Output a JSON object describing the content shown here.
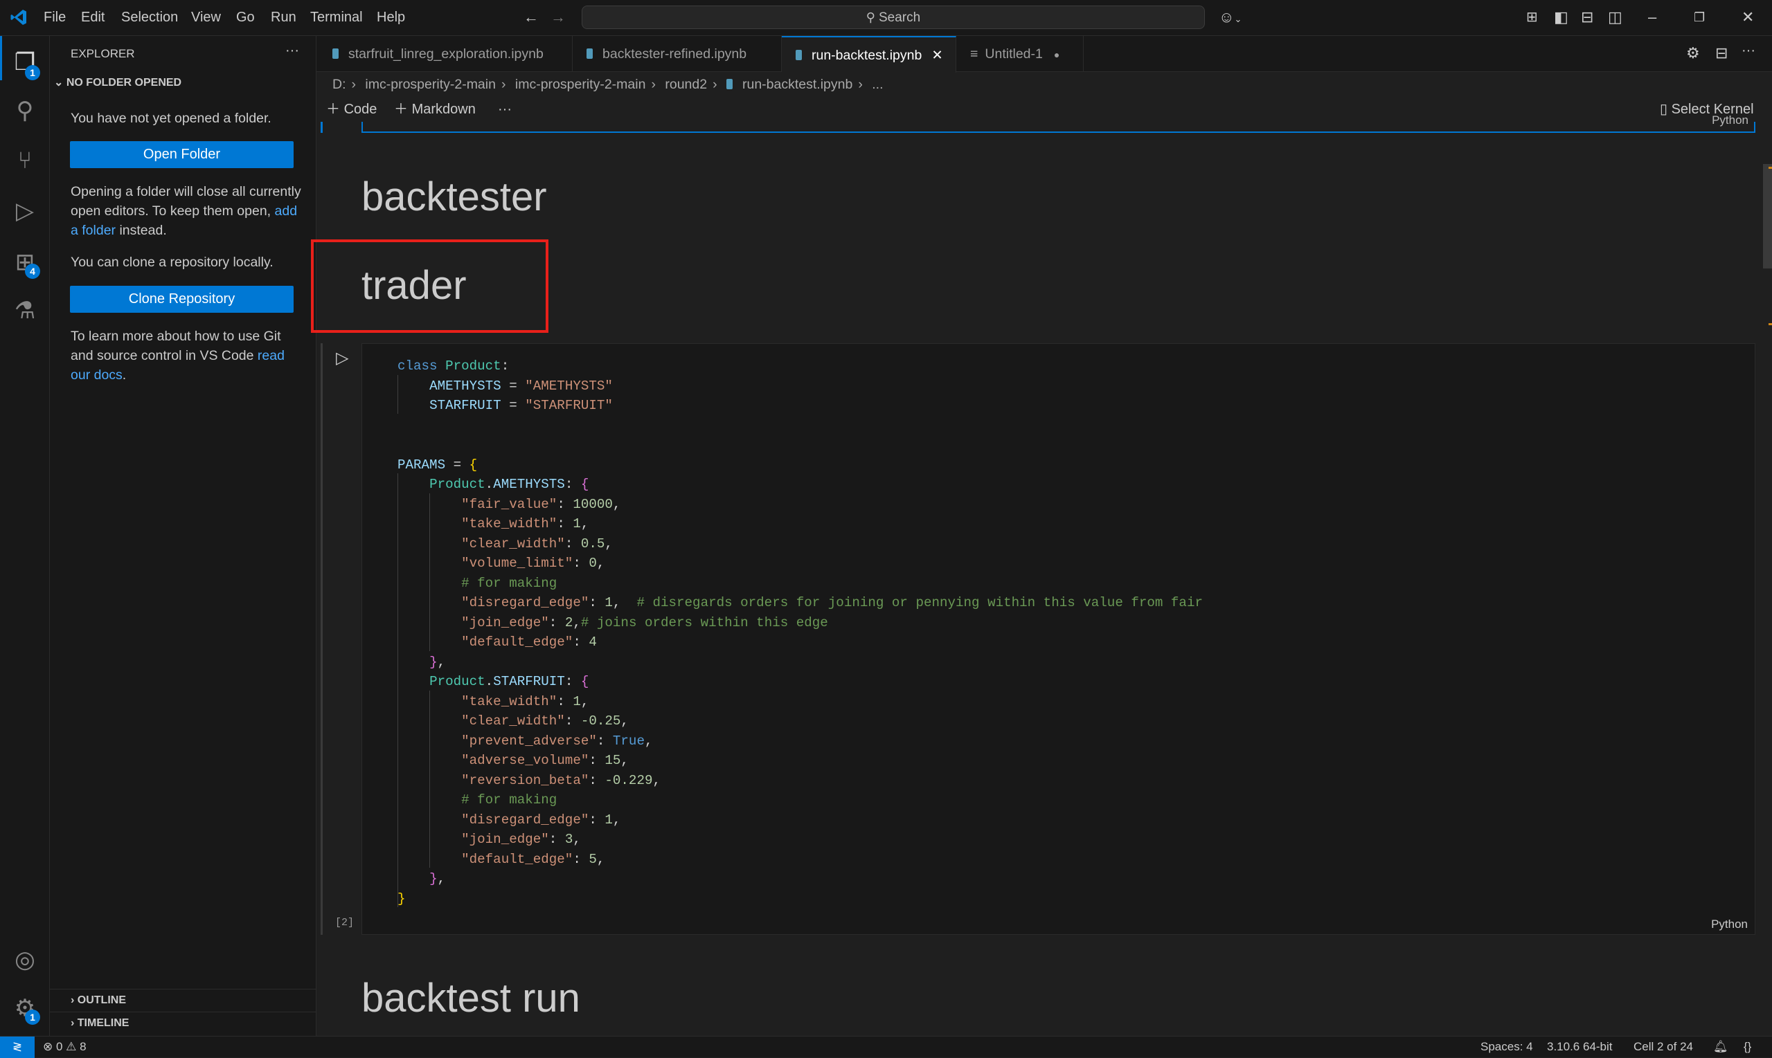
{
  "titlebar": {
    "menu": [
      "File",
      "Edit",
      "Selection",
      "View",
      "Go",
      "Run",
      "Terminal",
      "Help"
    ],
    "search_placeholder": "Search"
  },
  "activity_bar": {
    "explorer_badge": "1",
    "extensions_badge": "4",
    "manage_badge": "1"
  },
  "sidebar": {
    "title": "EXPLORER",
    "section": "NO FOLDER OPENED",
    "no_folder_text": "You have not yet opened a folder.",
    "open_folder_button": "Open Folder",
    "opening_text_1": "Opening a folder will close all currently open editors. To keep them open, ",
    "add_folder_link": "add a folder",
    "opening_text_2": " instead.",
    "clone_text": "You can clone a repository locally.",
    "clone_button": "Clone Repository",
    "git_text": "To learn more about how to use Git and source control in VS Code ",
    "docs_link": "read our docs",
    "git_text_end": ".",
    "outline": "OUTLINE",
    "timeline": "TIMELINE"
  },
  "tabs": [
    {
      "label": "starfruit_linreg_exploration.ipynb"
    },
    {
      "label": "backtester-refined.ipynb"
    },
    {
      "label": "run-backtest.ipynb"
    },
    {
      "label": "Untitled-1"
    }
  ],
  "breadcrumb": [
    "D:",
    "imc-prosperity-2-main",
    "imc-prosperity-2-main",
    "round2",
    "run-backtest.ipynb",
    "..."
  ],
  "notebook_toolbar": {
    "code": "Code",
    "markdown": "Markdown",
    "select_kernel": "Select Kernel"
  },
  "cells": {
    "prev_language": "Python",
    "heading1": "backtester",
    "heading2": "trader",
    "code_exec_count": "[2]",
    "code_language": "Python",
    "heading3": "backtest run"
  },
  "code_lines": [
    [
      [
        "kw",
        "class"
      ],
      [
        "",
        " "
      ],
      [
        "cls",
        "Product"
      ],
      [
        "",
        ":"
      ]
    ],
    [
      [
        "",
        "    "
      ],
      [
        "var",
        "AMETHYSTS"
      ],
      [
        "",
        " = "
      ],
      [
        "str",
        "\"AMETHYSTS\""
      ]
    ],
    [
      [
        "",
        "    "
      ],
      [
        "var",
        "STARFRUIT"
      ],
      [
        "",
        " = "
      ],
      [
        "str",
        "\"STARFRUIT\""
      ]
    ],
    [],
    [],
    [
      [
        "var",
        "PARAMS"
      ],
      [
        "",
        " = "
      ],
      [
        "p1",
        "{"
      ]
    ],
    [
      [
        "",
        "    "
      ],
      [
        "cls",
        "Product"
      ],
      [
        "",
        "."
      ],
      [
        "var",
        "AMETHYSTS"
      ],
      [
        "",
        ": "
      ],
      [
        "p2",
        "{"
      ]
    ],
    [
      [
        "",
        "        "
      ],
      [
        "str",
        "\"fair_value\""
      ],
      [
        "",
        ": "
      ],
      [
        "num",
        "10000"
      ],
      [
        "",
        ","
      ]
    ],
    [
      [
        "",
        "        "
      ],
      [
        "str",
        "\"take_width\""
      ],
      [
        "",
        ": "
      ],
      [
        "num",
        "1"
      ],
      [
        "",
        ","
      ]
    ],
    [
      [
        "",
        "        "
      ],
      [
        "str",
        "\"clear_width\""
      ],
      [
        "",
        ": "
      ],
      [
        "num",
        "0.5"
      ],
      [
        "",
        ","
      ]
    ],
    [
      [
        "",
        "        "
      ],
      [
        "str",
        "\"volume_limit\""
      ],
      [
        "",
        ": "
      ],
      [
        "num",
        "0"
      ],
      [
        "",
        ","
      ]
    ],
    [
      [
        "",
        "        "
      ],
      [
        "cmt",
        "# for making"
      ]
    ],
    [
      [
        "",
        "        "
      ],
      [
        "str",
        "\"disregard_edge\""
      ],
      [
        "",
        ": "
      ],
      [
        "num",
        "1"
      ],
      [
        "",
        ",  "
      ],
      [
        "cmt",
        "# disregards orders for joining or pennying within this value from fair"
      ]
    ],
    [
      [
        "",
        "        "
      ],
      [
        "str",
        "\"join_edge\""
      ],
      [
        "",
        ": "
      ],
      [
        "num",
        "2"
      ],
      [
        "",
        ","
      ],
      [
        "cmt",
        "# joins orders within this edge"
      ]
    ],
    [
      [
        "",
        "        "
      ],
      [
        "str",
        "\"default_edge\""
      ],
      [
        "",
        ": "
      ],
      [
        "num",
        "4"
      ]
    ],
    [
      [
        "",
        "    "
      ],
      [
        "p2",
        "}"
      ],
      [
        "",
        ","
      ]
    ],
    [
      [
        "",
        "    "
      ],
      [
        "cls",
        "Product"
      ],
      [
        "",
        "."
      ],
      [
        "var",
        "STARFRUIT"
      ],
      [
        "",
        ": "
      ],
      [
        "p2",
        "{"
      ]
    ],
    [
      [
        "",
        "        "
      ],
      [
        "str",
        "\"take_width\""
      ],
      [
        "",
        ": "
      ],
      [
        "num",
        "1"
      ],
      [
        "",
        ","
      ]
    ],
    [
      [
        "",
        "        "
      ],
      [
        "str",
        "\"clear_width\""
      ],
      [
        "",
        ": "
      ],
      [
        "num",
        "-0.25"
      ],
      [
        "",
        ","
      ]
    ],
    [
      [
        "",
        "        "
      ],
      [
        "str",
        "\"prevent_adverse\""
      ],
      [
        "",
        ": "
      ],
      [
        "con",
        "True"
      ],
      [
        "",
        ","
      ]
    ],
    [
      [
        "",
        "        "
      ],
      [
        "str",
        "\"adverse_volume\""
      ],
      [
        "",
        ": "
      ],
      [
        "num",
        "15"
      ],
      [
        "",
        ","
      ]
    ],
    [
      [
        "",
        "        "
      ],
      [
        "str",
        "\"reversion_beta\""
      ],
      [
        "",
        ": "
      ],
      [
        "num",
        "-0.229"
      ],
      [
        "",
        ","
      ]
    ],
    [
      [
        "",
        "        "
      ],
      [
        "cmt",
        "# for making"
      ]
    ],
    [
      [
        "",
        "        "
      ],
      [
        "str",
        "\"disregard_edge\""
      ],
      [
        "",
        ": "
      ],
      [
        "num",
        "1"
      ],
      [
        "",
        ","
      ]
    ],
    [
      [
        "",
        "        "
      ],
      [
        "str",
        "\"join_edge\""
      ],
      [
        "",
        ": "
      ],
      [
        "num",
        "3"
      ],
      [
        "",
        ","
      ]
    ],
    [
      [
        "",
        "        "
      ],
      [
        "str",
        "\"default_edge\""
      ],
      [
        "",
        ": "
      ],
      [
        "num",
        "5"
      ],
      [
        "",
        ","
      ]
    ],
    [
      [
        "",
        "    "
      ],
      [
        "p2",
        "}"
      ],
      [
        "",
        ","
      ]
    ],
    [
      [
        "p1",
        "}"
      ]
    ]
  ],
  "status_bar": {
    "errors": "0",
    "warnings": "8",
    "spaces": "Spaces: 4",
    "python_version": "3.10.6 64-bit",
    "cell_position": "Cell 2 of 24"
  },
  "colors": {
    "accent": "#0078d4",
    "highlight_box": "#e8201a"
  }
}
